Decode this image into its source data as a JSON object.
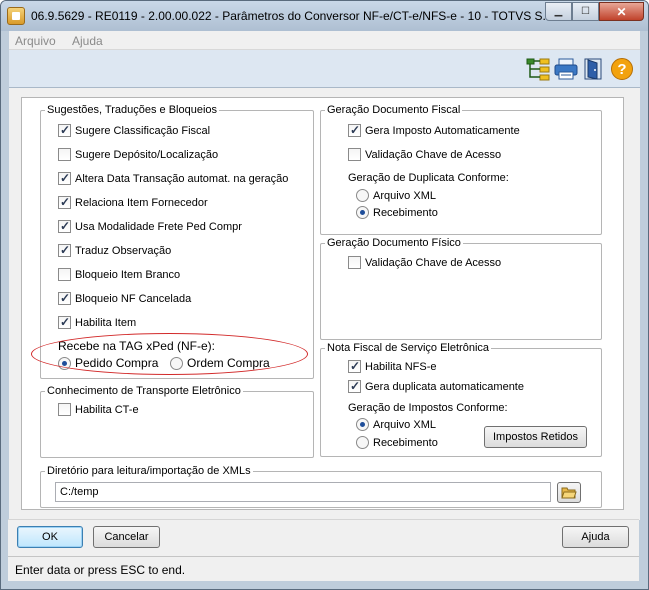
{
  "window": {
    "title": "06.9.5629 - RE0119 - 2.00.00.022 - Parâmetros do Conversor NF-e/CT-e/NFS-e - 10 - TOTVS S..."
  },
  "menu": {
    "items": [
      "Arquivo",
      "Ajuda"
    ]
  },
  "toolbar": {
    "icons": [
      "tree-icon",
      "printer-icon",
      "exit-door-icon",
      "help-icon"
    ]
  },
  "sugestoes": {
    "legend": "Sugestões, Traduções e Bloqueios",
    "items": [
      {
        "label": "Sugere Classificação Fiscal",
        "checked": true
      },
      {
        "label": "Sugere Depósito/Localização",
        "checked": false
      },
      {
        "label": "Altera Data Transação automat. na geração",
        "checked": true
      },
      {
        "label": "Relaciona Item Fornecedor",
        "checked": true
      },
      {
        "label": "Usa Modalidade Frete Ped Compr",
        "checked": true
      },
      {
        "label": "Traduz Observação",
        "checked": true
      },
      {
        "label": "Bloqueio Item Branco",
        "checked": false
      },
      {
        "label": "Bloqueio NF Cancelada",
        "checked": true
      },
      {
        "label": "Habilita Item",
        "checked": true
      }
    ],
    "xped_label": "Recebe na TAG xPed (NF-e):",
    "xped_options": [
      {
        "label": "Pedido Compra",
        "selected": true
      },
      {
        "label": "Ordem Compra",
        "selected": false
      }
    ]
  },
  "cte": {
    "legend": "Conhecimento de Transporte Eletrônico",
    "habilita": {
      "label": "Habilita CT-e",
      "checked": false
    }
  },
  "fiscal": {
    "legend": "Geração Documento Fiscal",
    "gera_imposto": {
      "label": "Gera Imposto Automaticamente",
      "checked": true
    },
    "validacao": {
      "label": "Validação Chave de Acesso",
      "checked": false
    },
    "duplicata_label": "Geração de Duplicata Conforme:",
    "duplicata_options": [
      {
        "label": "Arquivo XML",
        "selected": false
      },
      {
        "label": "Recebimento",
        "selected": true
      }
    ]
  },
  "fisico": {
    "legend": "Geração Documento Físico",
    "validacao": {
      "label": "Validação Chave de Acesso",
      "checked": false
    }
  },
  "nfse": {
    "legend": "Nota Fiscal de Serviço Eletrônica",
    "habilita": {
      "label": "Habilita NFS-e",
      "checked": true
    },
    "gera_duplicata": {
      "label": "Gera duplicata automaticamente",
      "checked": true
    },
    "impostos_label": "Geração de Impostos Conforme:",
    "impostos_options": [
      {
        "label": "Arquivo XML",
        "selected": true
      },
      {
        "label": "Recebimento",
        "selected": false
      }
    ],
    "impostos_retidos_button": "Impostos Retidos"
  },
  "diretorio": {
    "legend": "Diretório para leitura/importação de XMLs",
    "value": "C:/temp"
  },
  "buttons": {
    "ok": "OK",
    "cancelar": "Cancelar",
    "ajuda": "Ajuda"
  },
  "status": {
    "text": "Enter data or press ESC to end."
  },
  "colors": {
    "highlight_oval": "#d22a2a",
    "toolbar_bg": "#dde7f2",
    "window_frame": "#bfcddb"
  }
}
